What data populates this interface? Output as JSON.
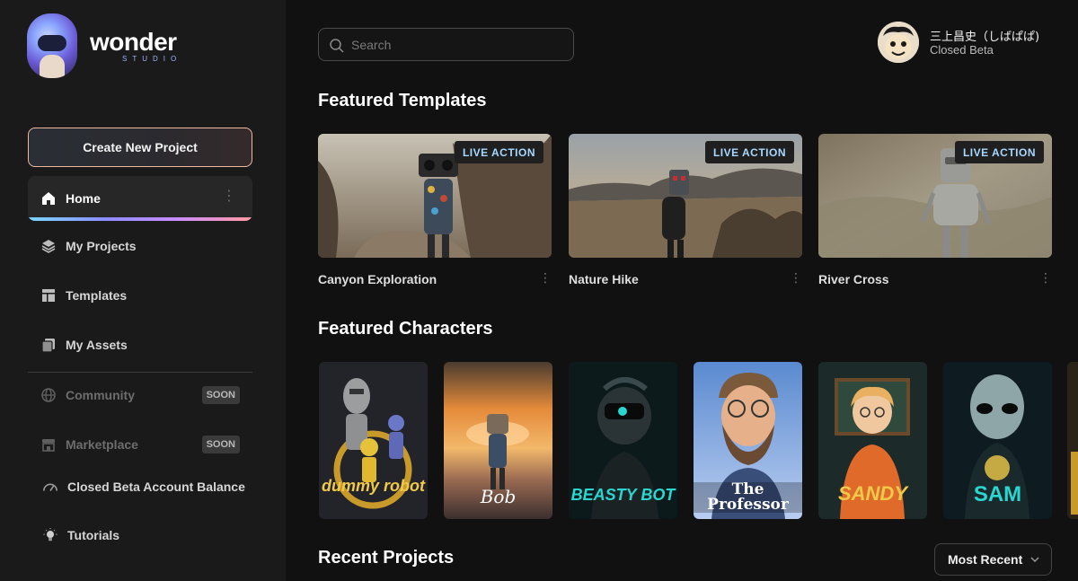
{
  "brand": {
    "name": "wonder",
    "sub": "STUDIO"
  },
  "sidebar": {
    "create_label": "Create New Project",
    "home": {
      "label": "Home",
      "more": "⋮"
    },
    "items": [
      {
        "label": "My Projects",
        "icon": "layers-icon"
      },
      {
        "label": "Templates",
        "icon": "template-icon"
      },
      {
        "label": "My Assets",
        "icon": "assets-icon"
      },
      {
        "label": "Community",
        "icon": "globe-icon",
        "badge": "SOON"
      },
      {
        "label": "Marketplace",
        "icon": "store-icon",
        "badge": "SOON"
      },
      {
        "label": "Closed Beta Account Balance",
        "icon": "gauge-icon"
      },
      {
        "label": "Tutorials",
        "icon": "lightbulb-icon"
      }
    ]
  },
  "search": {
    "placeholder": "Search"
  },
  "user": {
    "name": "三上昌史（しばぱぱ)",
    "status": "Closed Beta"
  },
  "featured_templates": {
    "title": "Featured Templates",
    "items": [
      {
        "tag": "LIVE ACTION",
        "name": "Canyon Exploration",
        "more": "⋮"
      },
      {
        "tag": "LIVE ACTION",
        "name": "Nature Hike",
        "more": "⋮"
      },
      {
        "tag": "LIVE ACTION",
        "name": "River Cross",
        "more": "⋮"
      }
    ]
  },
  "featured_characters": {
    "title": "Featured Characters",
    "items": [
      {
        "name": "dummy robot"
      },
      {
        "name": "Bob"
      },
      {
        "name": "BEASTY BOT"
      },
      {
        "name": "The Professor"
      },
      {
        "name": "SANDY"
      },
      {
        "name": "SAM"
      }
    ]
  },
  "recent_projects": {
    "title": "Recent Projects",
    "sort_label": "Most Recent"
  },
  "colors": {
    "accent_border": "#f1b79f",
    "tag_text": "#a8d8ff"
  }
}
